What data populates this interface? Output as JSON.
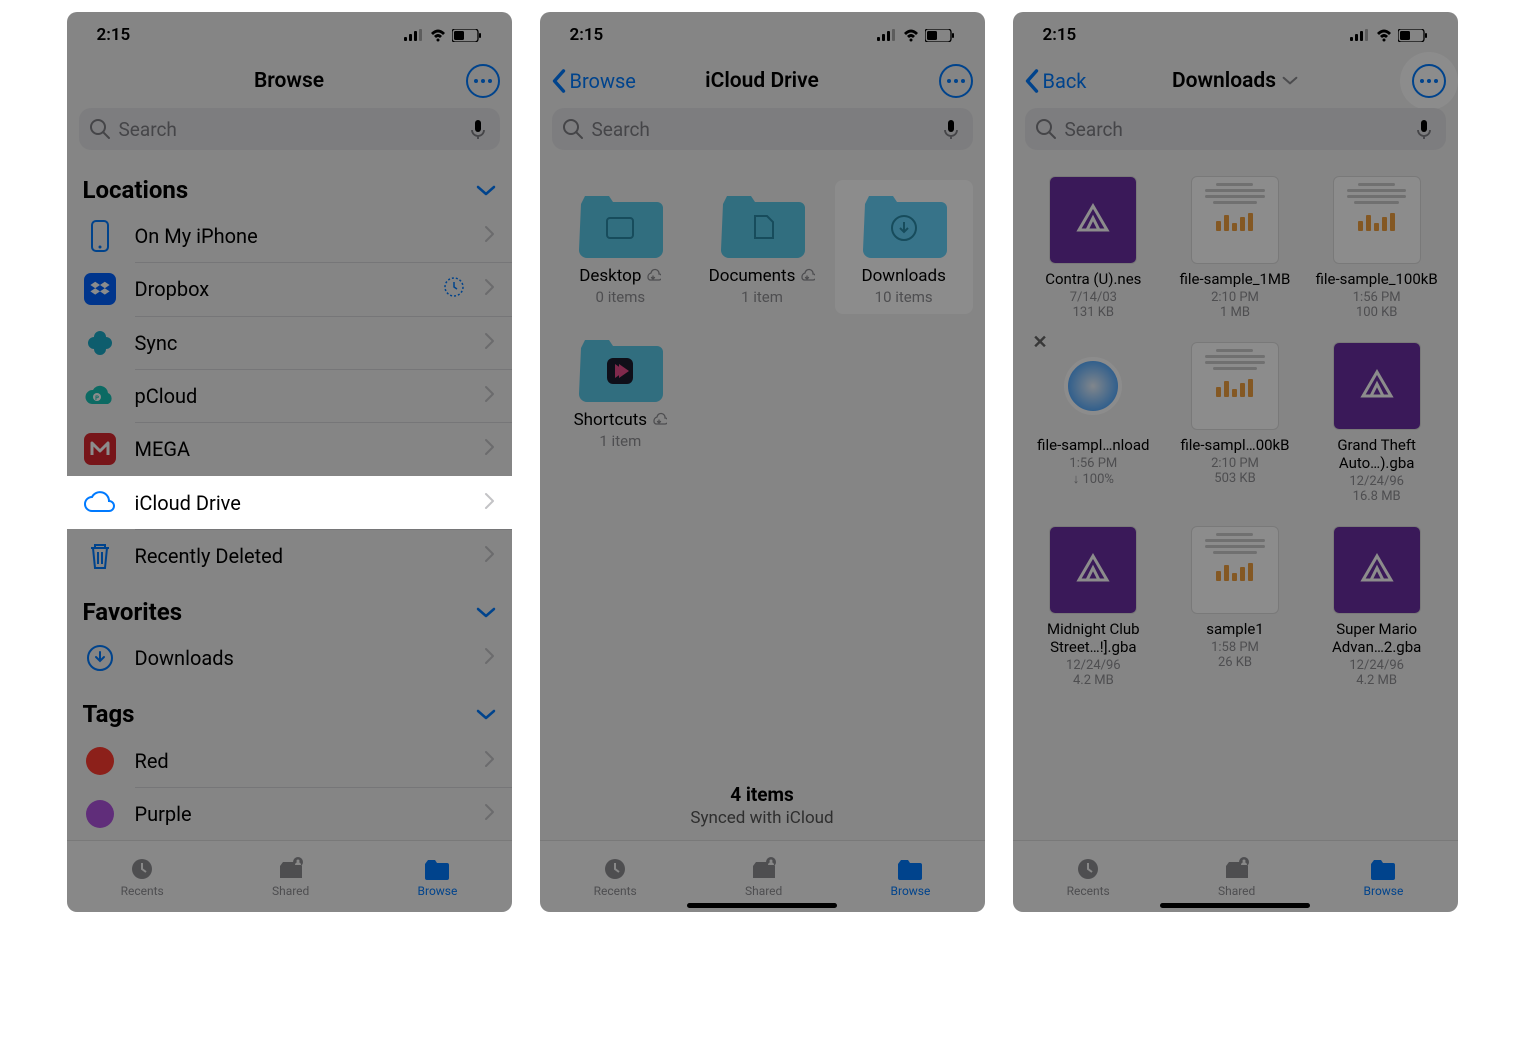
{
  "status": {
    "time": "2:15",
    "battery": "41"
  },
  "screen1": {
    "title": "Browse",
    "search_placeholder": "Search",
    "sections": {
      "locations": {
        "header": "Locations",
        "items": [
          {
            "label": "On My iPhone"
          },
          {
            "label": "Dropbox"
          },
          {
            "label": "Sync"
          },
          {
            "label": "pCloud"
          },
          {
            "label": "MEGA"
          },
          {
            "label": "iCloud Drive"
          },
          {
            "label": "Recently Deleted"
          }
        ]
      },
      "favorites": {
        "header": "Favorites",
        "items": [
          {
            "label": "Downloads"
          }
        ]
      },
      "tags": {
        "header": "Tags",
        "items": [
          {
            "label": "Red",
            "color": "#ff3b30"
          },
          {
            "label": "Purple",
            "color": "#af52de"
          }
        ]
      }
    }
  },
  "screen2": {
    "back": "Browse",
    "title": "iCloud Drive",
    "search_placeholder": "Search",
    "folders": [
      {
        "name": "Desktop",
        "meta": "0 items",
        "cloud": true,
        "glyph": "desktop"
      },
      {
        "name": "Documents",
        "meta": "1 item",
        "cloud": true,
        "glyph": "doc"
      },
      {
        "name": "Downloads",
        "meta": "10 items",
        "cloud": false,
        "glyph": "download"
      },
      {
        "name": "Shortcuts",
        "meta": "1 item",
        "cloud": true,
        "glyph": "shortcuts"
      }
    ],
    "footer_count": "4 items",
    "footer_sync": "Synced with iCloud"
  },
  "screen3": {
    "back": "Back",
    "title": "Downloads",
    "search_placeholder": "Search",
    "files": [
      {
        "name": "Contra (U).nes",
        "time": "7/14/03",
        "size": "131 KB",
        "thumb": "purple"
      },
      {
        "name": "file-sample_1MB",
        "time": "2:10 PM",
        "size": "1 MB",
        "thumb": "doc"
      },
      {
        "name": "file-sample_100kB",
        "time": "1:56 PM",
        "size": "100 KB",
        "thumb": "doc"
      },
      {
        "name": "file-sampl…nload",
        "time": "1:56 PM",
        "size": "↓ 100%",
        "thumb": "safari",
        "close": true
      },
      {
        "name": "file-sampl…00kB",
        "time": "2:10 PM",
        "size": "503 KB",
        "thumb": "doc"
      },
      {
        "name": "Grand Theft Auto…).gba",
        "time": "12/24/96",
        "size": "16.8 MB",
        "thumb": "purple"
      },
      {
        "name": "Midnight Club Street…!].gba",
        "time": "12/24/96",
        "size": "4.2 MB",
        "thumb": "purple"
      },
      {
        "name": "sample1",
        "time": "1:58 PM",
        "size": "26 KB",
        "thumb": "doc"
      },
      {
        "name": "Super Mario Advan…2.gba",
        "time": "12/24/96",
        "size": "4.2 MB",
        "thumb": "purple"
      }
    ]
  },
  "tabs": {
    "recents": "Recents",
    "shared": "Shared",
    "browse": "Browse"
  }
}
